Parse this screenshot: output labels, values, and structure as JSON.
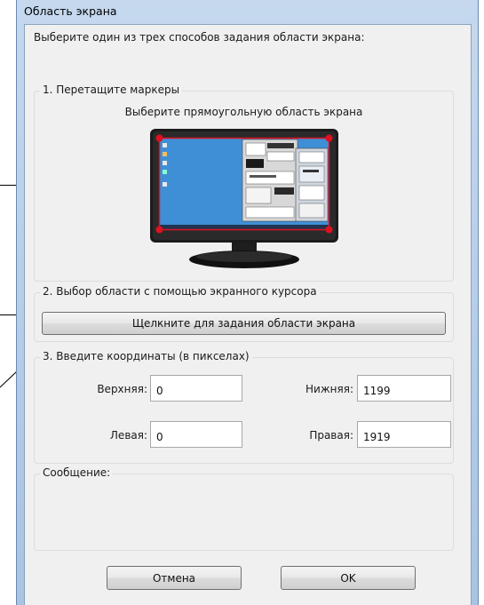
{
  "window": {
    "title": "Область экрана"
  },
  "intro": "Выберите один из трех способов задания области экрана:",
  "drag_group": {
    "legend": "1. Перетащите маркеры",
    "subtitle": "Выберите прямоугольную область экрана"
  },
  "cursor_group": {
    "legend": "2. Выбор области с помощью экранного курсора",
    "button_label": "Щелкните для задания области экрана"
  },
  "coords_group": {
    "legend": "3. Введите координаты (в пикселах)",
    "top": {
      "label": "Верхняя:",
      "value": "0"
    },
    "bottom": {
      "label": "Нижняя:",
      "value": "1199"
    },
    "left": {
      "label": "Левая:",
      "value": "0"
    },
    "right": {
      "label": "Правая:",
      "value": "1919"
    }
  },
  "message_group": {
    "legend": "Сообщение:"
  },
  "buttons": {
    "cancel": "Отмена",
    "ok": "OK"
  },
  "colors": {
    "screen_blue": "#3f8fd6",
    "marker_red": "#e01020",
    "frame_blue": "#a9c3e2"
  },
  "icons": [
    "drag-handle-icon"
  ]
}
